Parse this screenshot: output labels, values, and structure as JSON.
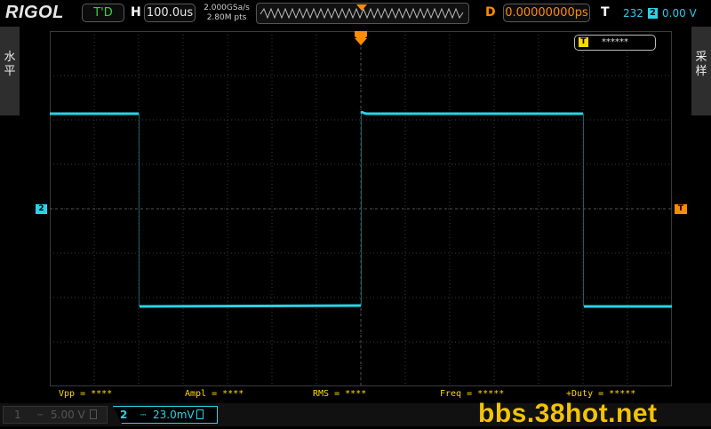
{
  "brand": "RIGOL",
  "header": {
    "run_state": "T'D",
    "horizontal_label": "H",
    "timebase": "100.0us",
    "sample_rate": "2.000GSa/s",
    "memory_depth": "2.80M pts",
    "delay_label": "D",
    "delay": "0.00000000ps",
    "trigger_label": "T",
    "trigger_count": "232",
    "trigger_source": "2",
    "trigger_level": "0.00 V"
  },
  "side_tabs": {
    "left": [
      "水",
      "平"
    ],
    "right": [
      "采",
      "样"
    ]
  },
  "markers": {
    "channel2": "2",
    "trigger_position": "T",
    "trigger_level": "T"
  },
  "trigger_box": {
    "icon": "T",
    "text": "******"
  },
  "measurements": [
    "Vpp = ****",
    "Ampl = ****",
    "RMS = ****",
    "Freq = *****",
    "+Duty = *****"
  ],
  "channels": [
    {
      "id": "1",
      "scale": "5.00 V",
      "color": "#555555"
    },
    {
      "id": "2",
      "scale": "23.0mV",
      "color": "#29d3e8"
    }
  ],
  "trace_color": "#29d3e8",
  "grid_color": "#3a3a3a",
  "accent_orange": "#ff8c00",
  "watermark": "bbs.38hot.net"
}
